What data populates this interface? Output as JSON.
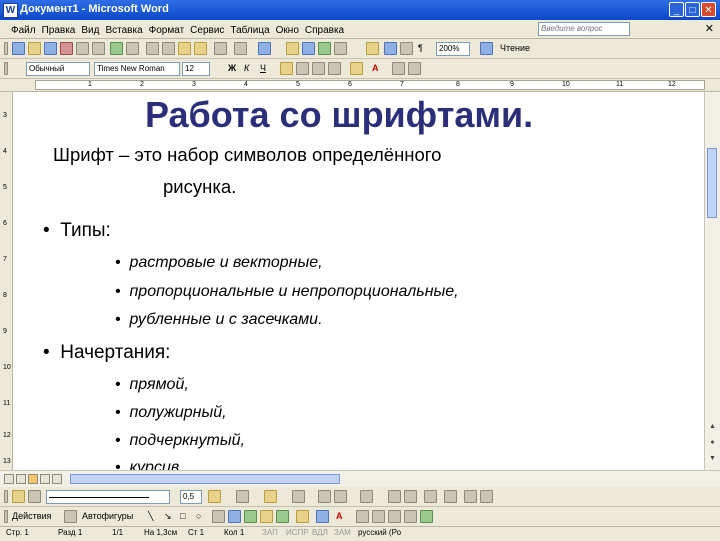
{
  "window": {
    "title": "Документ1 - Microsoft Word",
    "app_icon": "W"
  },
  "menu": [
    "Файл",
    "Правка",
    "Вид",
    "Вставка",
    "Формат",
    "Сервис",
    "Таблица",
    "Окно",
    "Справка"
  ],
  "help_box": {
    "placeholder": "Введите вопрос"
  },
  "toolbar_format": {
    "style": "Обычный",
    "font": "Times New Roman",
    "size": "12",
    "zoom": "200%",
    "read_label": "Чтение"
  },
  "ruler": [
    "1",
    "2",
    "3",
    "4",
    "5",
    "6",
    "7",
    "8",
    "9",
    "10",
    "11",
    "12"
  ],
  "vruler": [
    "3",
    "4",
    "5",
    "6",
    "7",
    "8",
    "9",
    "10",
    "11",
    "12",
    "13"
  ],
  "document": {
    "title": "Работа со шрифтами.",
    "definition_line1": "Шрифт – это набор символов определённого",
    "definition_line2": "рисунка.",
    "types_heading": "Типы:",
    "types": [
      "растровые и векторные,",
      "пропорциональные и непропорциональные,",
      "рубленные и с засечками."
    ],
    "styles_heading": "Начертания:",
    "styles": [
      "прямой,",
      "полужирный,",
      "подчеркнутый,",
      "курсив."
    ]
  },
  "drawing_toolbar": {
    "line_width": "0,5",
    "actions": "Действия",
    "autoshapes": "Автофигуры"
  },
  "status": {
    "page": "Стр. 1",
    "section": "Разд 1",
    "pages": "1/1",
    "position": "На 1,3см",
    "line": "Ст 1",
    "col": "Кол 1",
    "rec": "ЗАП",
    "trk": "ИСПР",
    "ext": "ВДЛ",
    "ovr": "ЗАМ",
    "lang": "русский (Ро"
  }
}
